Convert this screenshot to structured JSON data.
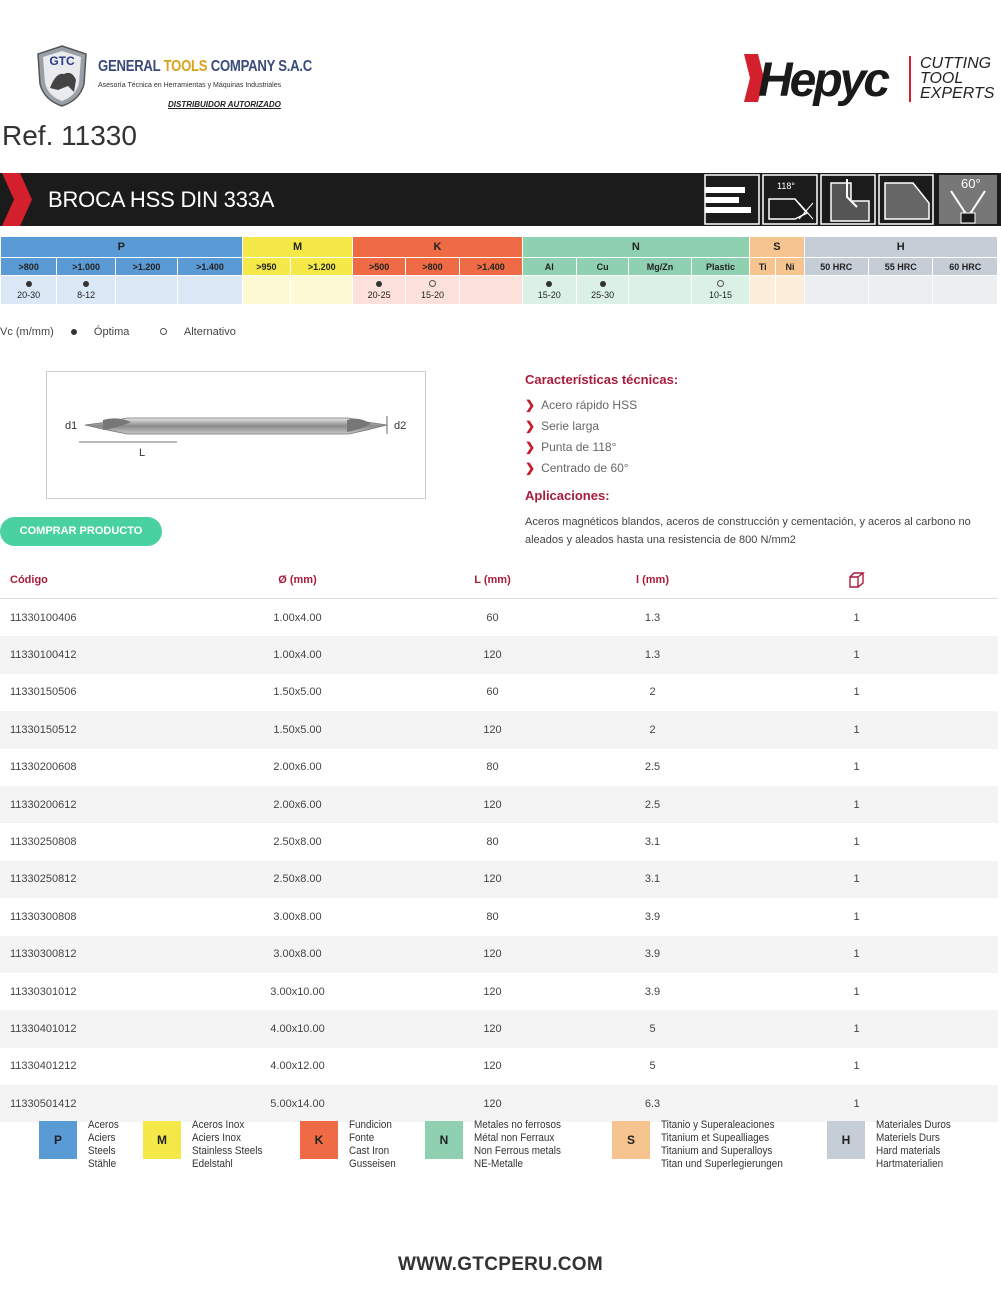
{
  "header": {
    "gtc_badge": "GTC",
    "company_a": "GENERAL ",
    "company_b": "TOOLS",
    "company_c": " COMPANY S.A.C",
    "subtitle": "Asesoría Técnica en Herramientas y Máquinas Industriales",
    "distributor": "DISTRIBUIDOR AUTORIZADO",
    "brand": "Hepyc",
    "slogan_1": "CUTTING",
    "slogan_2": "TOOL",
    "slogan_3": "EXPERTS",
    "ref": "Ref. 11330"
  },
  "band": {
    "title": "BROCA HSS DIN 333A",
    "angle_1": "118°",
    "angle_2": "60°",
    "icons": [
      "long-series-icon",
      "point-118-icon",
      "center-cut-icon",
      "drill-tip-icon",
      "countersink-60-icon"
    ]
  },
  "materials": {
    "groups": [
      {
        "label": "P",
        "color": "#5b9bd5",
        "light": "#dbe9f7",
        "subs": [
          ">800",
          ">1.000",
          ">1.200",
          ">1.400"
        ],
        "vals": [
          [
            "dot",
            "20-30"
          ],
          [
            "dot",
            "8-12"
          ],
          [
            "",
            ""
          ],
          [
            "",
            ""
          ]
        ]
      },
      {
        "label": "M",
        "color": "#f5e94a",
        "light": "#fdf9d3",
        "subs": [
          ">950",
          ">1.200"
        ],
        "vals": [
          [
            "",
            ""
          ],
          [
            "",
            ""
          ]
        ]
      },
      {
        "label": "K",
        "color": "#ee6b45",
        "light": "#fbe1d9",
        "subs": [
          ">500",
          ">800",
          ">1.400"
        ],
        "vals": [
          [
            "dot",
            "20-25"
          ],
          [
            "odot",
            "15-20"
          ],
          [
            "",
            ""
          ]
        ]
      },
      {
        "label": "N",
        "color": "#8fd0b0",
        "light": "#dcf1e6",
        "subs": [
          "Al",
          "Cu",
          "Mg/Zn",
          "Plastic"
        ],
        "vals": [
          [
            "dot",
            "15-20"
          ],
          [
            "dot",
            "25-30"
          ],
          [
            "",
            ""
          ],
          [
            "odot",
            "10-15"
          ]
        ]
      },
      {
        "label": "S",
        "color": "#f6c48e",
        "light": "#fdeedc",
        "subs": [
          "Ti",
          "Ni"
        ],
        "vals": [
          [
            "",
            ""
          ],
          [
            "",
            ""
          ]
        ]
      },
      {
        "label": "H",
        "color": "#c5ced6",
        "light": "#eceff2",
        "subs": [
          "50 HRC",
          "55 HRC",
          "60 HRC"
        ],
        "vals": [
          [
            "",
            ""
          ],
          [
            "",
            ""
          ],
          [
            "",
            ""
          ]
        ]
      }
    ],
    "legend": {
      "vc": "Vc (m/mm)",
      "optimal": "Óptima",
      "alternative": "Alternativo"
    }
  },
  "diagram": {
    "d1": "d1",
    "d2": "d2",
    "L": "L"
  },
  "characteristics": {
    "title": "Características técnicas:",
    "items": [
      "Acero rápido HSS",
      "Serie larga",
      "Punta de 118°",
      "Centrado de 60°"
    ]
  },
  "applications": {
    "title": "Aplicaciones:",
    "text": "Aceros magnéticos blandos, aceros de construcción y cementación, y aceros al carbono no aleados y aleados hasta una resistencia de 800 N/mm2"
  },
  "buy_button": "COMPRAR PRODUCTO",
  "products": {
    "headers": [
      "Código",
      "Ø (mm)",
      "L (mm)",
      "l (mm)"
    ],
    "rows": [
      [
        "11330100406",
        "1.00x4.00",
        "60",
        "1.3",
        "1"
      ],
      [
        "11330100412",
        "1.00x4.00",
        "120",
        "1.3",
        "1"
      ],
      [
        "11330150506",
        "1.50x5.00",
        "60",
        "2",
        "1"
      ],
      [
        "11330150512",
        "1.50x5.00",
        "120",
        "2",
        "1"
      ],
      [
        "11330200608",
        "2.00x6.00",
        "80",
        "2.5",
        "1"
      ],
      [
        "11330200612",
        "2.00x6.00",
        "120",
        "2.5",
        "1"
      ],
      [
        "11330250808",
        "2.50x8.00",
        "80",
        "3.1",
        "1"
      ],
      [
        "11330250812",
        "2.50x8.00",
        "120",
        "3.1",
        "1"
      ],
      [
        "11330300808",
        "3.00x8.00",
        "80",
        "3.9",
        "1"
      ],
      [
        "11330300812",
        "3.00x8.00",
        "120",
        "3.9",
        "1"
      ],
      [
        "11330301012",
        "3.00x10.00",
        "120",
        "3.9",
        "1"
      ],
      [
        "11330401012",
        "4.00x10.00",
        "120",
        "5",
        "1"
      ],
      [
        "11330401212",
        "4.00x12.00",
        "120",
        "5",
        "1"
      ],
      [
        "11330501412",
        "5.00x14.00",
        "120",
        "6.3",
        "1"
      ]
    ]
  },
  "material_legend": [
    {
      "code": "P",
      "color": "#5b9bd5",
      "lines": [
        "Aceros",
        "Aciers",
        "Steels",
        "Stähle"
      ]
    },
    {
      "code": "M",
      "color": "#f5e94a",
      "lines": [
        "Aceros Inox",
        "Aciers Inox",
        "Stainless Steels",
        "Edelstahl"
      ]
    },
    {
      "code": "K",
      "color": "#ee6b45",
      "lines": [
        "Fundicion",
        "Fonte",
        "Cast Iron",
        "Gusseisen"
      ]
    },
    {
      "code": "N",
      "color": "#8fd0b0",
      "lines": [
        "Metales no ferrosos",
        "Métal non Ferraux",
        "Non Ferrous metals",
        "NE-Metalle"
      ]
    },
    {
      "code": "S",
      "color": "#f6c48e",
      "lines": [
        "Titanio y Superaleaciones",
        "Titanium et Supealliages",
        "Titanium and Superalloys",
        "Titan und Superlegierungen"
      ]
    },
    {
      "code": "H",
      "color": "#c5ced6",
      "lines": [
        "Materiales Duros",
        "Materiels Durs",
        "Hard materials",
        "Hartmaterialien"
      ]
    }
  ],
  "footer": "WWW.GTCPERU.COM"
}
